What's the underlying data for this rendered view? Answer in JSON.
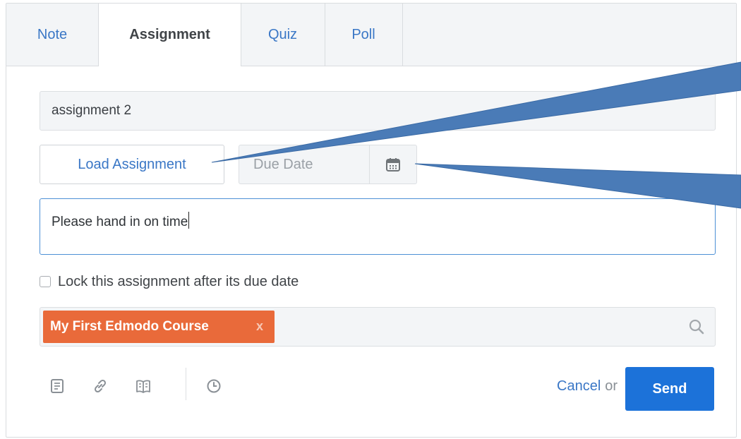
{
  "tabs": [
    {
      "label": "Note",
      "active": false
    },
    {
      "label": "Assignment",
      "active": true
    },
    {
      "label": "Quiz",
      "active": false
    },
    {
      "label": "Poll",
      "active": false
    }
  ],
  "form": {
    "title_value": "assignment 2",
    "load_button": "Load Assignment",
    "due_date_placeholder": "Due Date",
    "description_value": "Please hand in on time",
    "lock_label": "Lock this assignment after its due date",
    "lock_checked": false
  },
  "recipients": {
    "chips": [
      {
        "label": "My First Edmodo Course",
        "remove": "x"
      }
    ]
  },
  "toolbar": {
    "icons": [
      "file-icon",
      "link-icon",
      "library-icon",
      "clock-icon"
    ]
  },
  "actions": {
    "cancel_label": "Cancel",
    "or_text": "or",
    "send_label": "Send"
  },
  "colors": {
    "accent": "#3a77c6",
    "send": "#1c72d9",
    "chip": "#e96a3a",
    "callout_arrow": "#4a7bb7"
  }
}
